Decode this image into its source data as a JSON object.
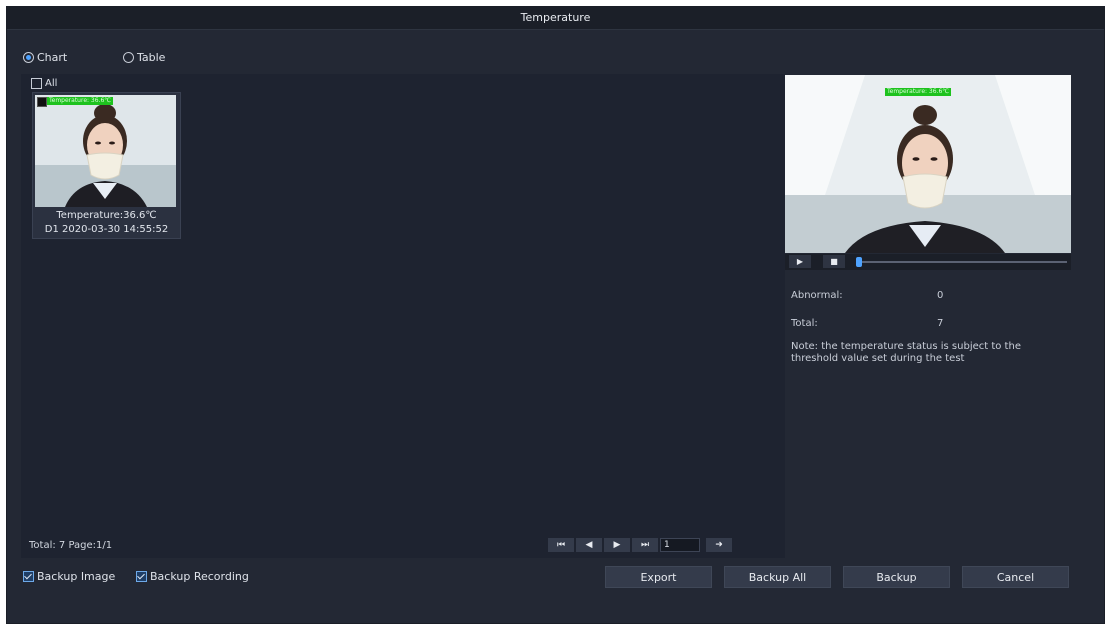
{
  "window": {
    "title": "Temperature"
  },
  "view_mode": {
    "chart_label": "Chart",
    "table_label": "Table",
    "selected": "Chart"
  },
  "grid": {
    "all_label": "All",
    "items": [
      {
        "temp_tag": "Temperature: 36.6℃",
        "temperature": "Temperature:36.6℃",
        "timestamp": "D1 2020-03-30 14:55:52"
      }
    ],
    "footer": "Total: 7  Page:1/1"
  },
  "pager": {
    "first_icon": "skip-first-icon",
    "prev_icon": "prev-icon",
    "next_icon": "next-icon",
    "last_icon": "skip-last-icon",
    "page_value": "1",
    "go_icon": "go-arrow-icon"
  },
  "preview": {
    "temp_tag": "Temperature: 36.6℃",
    "play_icon": "play-icon",
    "stop_icon": "stop-icon"
  },
  "stats": {
    "abnormal_label": "Abnormal:",
    "abnormal_value": "0",
    "total_label": "Total:",
    "total_value": "7",
    "note": "Note: the temperature status is subject to the threshold value set during the test"
  },
  "bottom": {
    "backup_image_label": "Backup Image",
    "backup_recording_label": "Backup Recording"
  },
  "actions": {
    "export_label": "Export",
    "backup_all_label": "Backup All",
    "backup_label": "Backup",
    "cancel_label": "Cancel"
  },
  "colors": {
    "accent": "#4fa3ff",
    "tag_green": "#1ec21e",
    "panel": "#232834"
  }
}
